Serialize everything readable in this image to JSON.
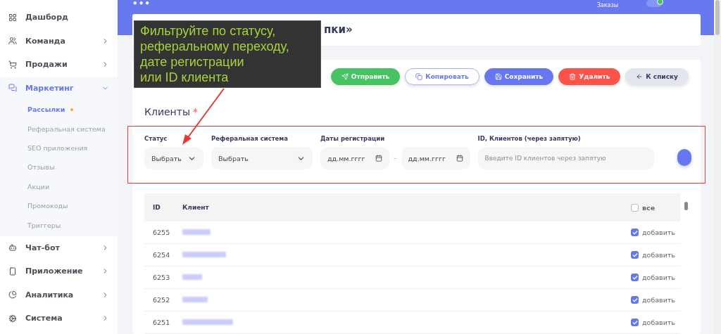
{
  "sidebar": {
    "items": [
      {
        "kind": "link",
        "label": "Дашборд",
        "expanded": false
      },
      {
        "kind": "group",
        "label": "Команда",
        "expanded": false
      },
      {
        "kind": "group",
        "label": "Продажи",
        "expanded": false
      },
      {
        "kind": "group",
        "label": "Маркетинг",
        "expanded": true,
        "children": [
          {
            "label": "Рассылки",
            "selected": true,
            "has_dot": true
          },
          {
            "label": "Реферальная система",
            "selected": false,
            "has_dot": false
          },
          {
            "label": "SEO приложения",
            "selected": false,
            "has_dot": false
          },
          {
            "label": "Отзывы",
            "selected": false,
            "has_dot": false
          },
          {
            "label": "Акции",
            "selected": false,
            "has_dot": false
          },
          {
            "label": "Промокоды",
            "selected": false,
            "has_dot": false
          },
          {
            "label": "Триггеры",
            "selected": false,
            "has_dot": false
          }
        ]
      },
      {
        "kind": "group",
        "label": "Чат-бот",
        "expanded": false
      },
      {
        "kind": "group",
        "label": "Приложение",
        "expanded": false
      },
      {
        "kind": "group",
        "label": "Аналитика",
        "expanded": false
      },
      {
        "kind": "group",
        "label": "Система",
        "expanded": false
      }
    ]
  },
  "topbar": {
    "menu": "•••",
    "orders_label": "Заказы",
    "toggle_on": true
  },
  "page_title": "пки»",
  "annotation": {
    "text": "Фильтруйте по статусу,\nреферальному переходу,\nдате регистрации\nили ID клиента"
  },
  "actions": [
    {
      "kind": "send",
      "label": "Отправить"
    },
    {
      "kind": "copy",
      "label": "Копировать"
    },
    {
      "kind": "save",
      "label": "Сохранить"
    },
    {
      "kind": "delete",
      "label": "Удалить"
    },
    {
      "kind": "back",
      "label": "К списку"
    }
  ],
  "section_title": "Клиенты",
  "required_mark": "*",
  "filters": {
    "status": {
      "label": "Статус",
      "value": "Выбрать"
    },
    "referral": {
      "label": "Реферальная система",
      "value": "Выбрать"
    },
    "dates": {
      "label": "Даты регистрации",
      "from_placeholder": "дд.мм.гггг",
      "separator": "–",
      "to_placeholder": "дд.мм.гггг"
    },
    "ids": {
      "label": "ID, Клиентов (через запятую)",
      "placeholder": "Введите ID клиентов через запятую"
    }
  },
  "table": {
    "columns": [
      "ID",
      "Клиент"
    ],
    "select_all": {
      "label": "все",
      "checked": false
    },
    "rows": [
      {
        "id": "6255",
        "checked": true,
        "action": "добавить"
      },
      {
        "id": "6254",
        "checked": true,
        "action": "добавить"
      },
      {
        "id": "6253",
        "checked": true,
        "action": "добавить"
      },
      {
        "id": "6252",
        "checked": true,
        "action": "добавить"
      },
      {
        "id": "6251",
        "checked": true,
        "action": "добавить"
      }
    ]
  }
}
